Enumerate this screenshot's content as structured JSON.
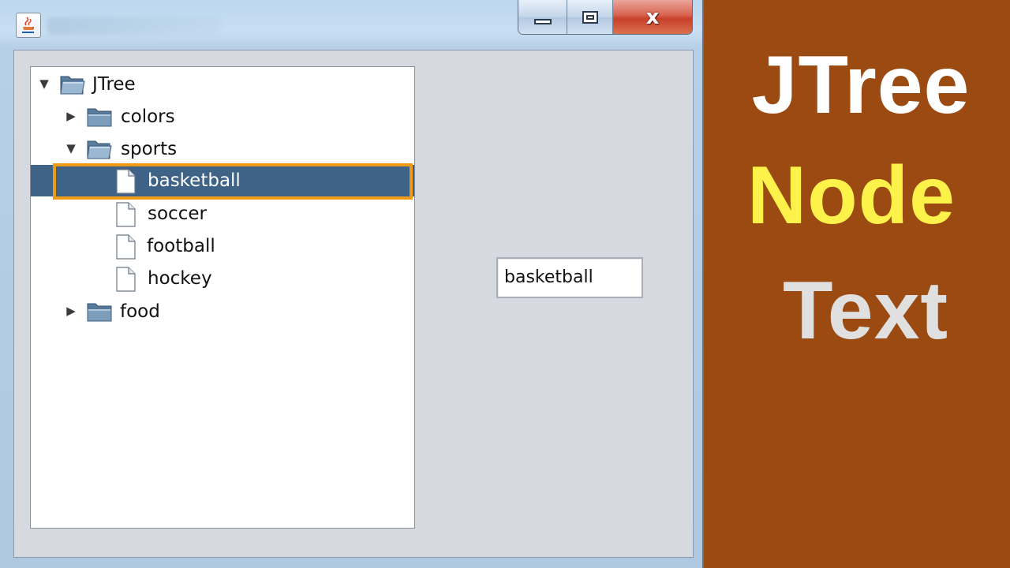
{
  "window": {
    "buttons": {
      "minimize": "",
      "maximize": "",
      "close": "x"
    }
  },
  "tree": {
    "nodes": [
      {
        "label": "JTree"
      },
      {
        "label": "colors"
      },
      {
        "label": "sports"
      },
      {
        "label": "basketball"
      },
      {
        "label": "soccer"
      },
      {
        "label": "football"
      },
      {
        "label": "hockey"
      },
      {
        "label": "food"
      }
    ],
    "selected": "basketball"
  },
  "textfield": {
    "value": "basketball"
  },
  "banner": {
    "line1": "JTree",
    "line2": "Node",
    "line3": "Text"
  },
  "colors": {
    "banner_bg": "#9b4a11",
    "selection_bg": "#3e6387",
    "selection_outline": "#ef9a15",
    "line2_color": "#fdf24a"
  },
  "icons": {
    "app": "java-cup-icon",
    "folder_open": "folder-open-icon",
    "folder_closed": "folder-closed-icon",
    "leaf": "document-icon",
    "expanded": "triangle-down-icon",
    "collapsed": "triangle-right-icon"
  }
}
